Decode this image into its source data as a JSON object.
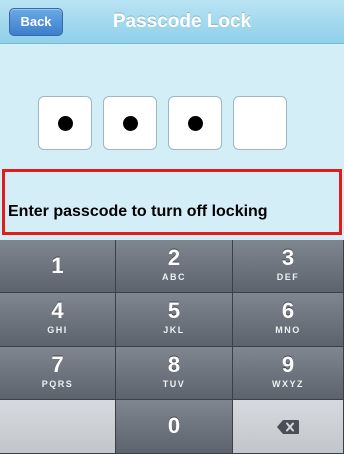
{
  "navbar": {
    "back_label": "Back",
    "title": "Passcode Lock"
  },
  "passcode": {
    "length": 4,
    "filled": 3
  },
  "prompt": {
    "text": "Enter passcode to turn off locking"
  },
  "keypad": {
    "keys": [
      {
        "digit": "1",
        "letters": ""
      },
      {
        "digit": "2",
        "letters": "ABC"
      },
      {
        "digit": "3",
        "letters": "DEF"
      },
      {
        "digit": "4",
        "letters": "GHI"
      },
      {
        "digit": "5",
        "letters": "JKL"
      },
      {
        "digit": "6",
        "letters": "MNO"
      },
      {
        "digit": "7",
        "letters": "PQRS"
      },
      {
        "digit": "8",
        "letters": "TUV"
      },
      {
        "digit": "9",
        "letters": "WXYZ"
      },
      {
        "digit": "0",
        "letters": ""
      }
    ],
    "delete_icon": "backspace-icon"
  },
  "colors": {
    "background": "#d4eef7",
    "highlight_border": "#e21b1b",
    "key_dark": "#5c636d"
  }
}
